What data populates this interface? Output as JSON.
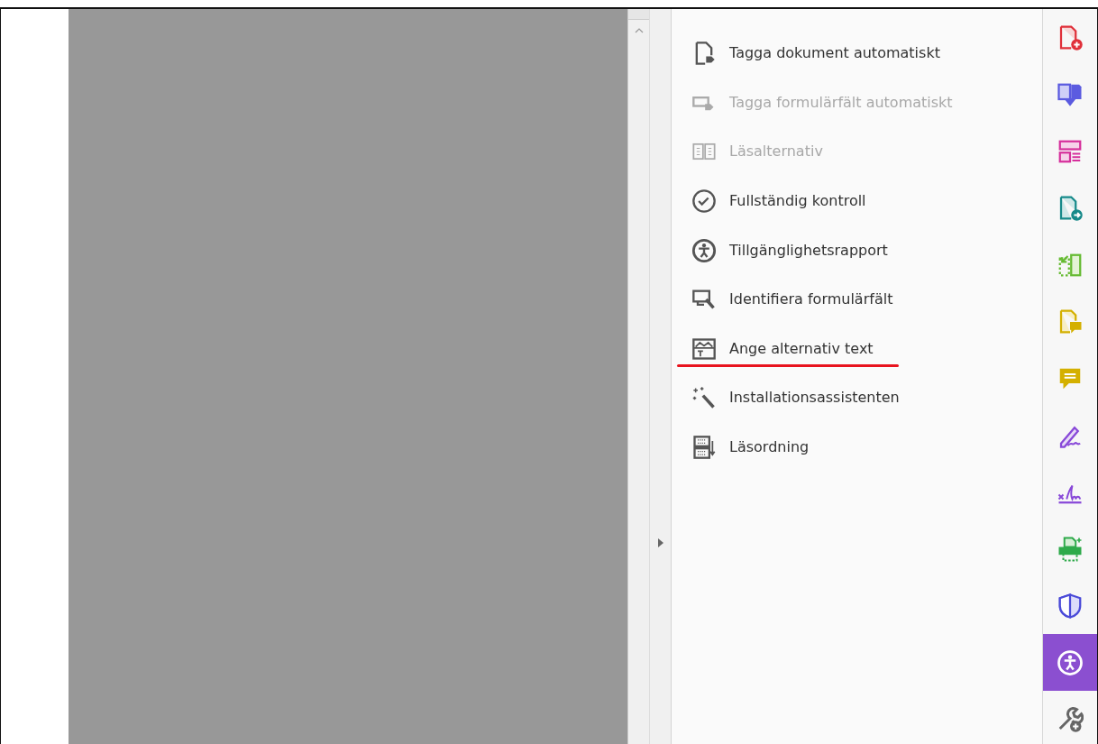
{
  "tools_panel": {
    "items": [
      {
        "label": "Tagga dokument automatiskt",
        "kind": "tagdoc",
        "disabled": false,
        "underlined": false
      },
      {
        "label": "Tagga formulärfält automatiskt",
        "kind": "tagform",
        "disabled": true,
        "underlined": false
      },
      {
        "label": "Läsalternativ",
        "kind": "reading",
        "disabled": true,
        "underlined": false
      },
      {
        "label": "Fullständig kontroll",
        "kind": "check",
        "disabled": false,
        "underlined": false
      },
      {
        "label": "Tillgänglighetsrapport",
        "kind": "access",
        "disabled": false,
        "underlined": false
      },
      {
        "label": "Identifiera formulärfält",
        "kind": "identify",
        "disabled": false,
        "underlined": false
      },
      {
        "label": "Ange alternativ text",
        "kind": "alttext",
        "disabled": false,
        "underlined": true
      },
      {
        "label": "Installationsassistenten",
        "kind": "wizard",
        "disabled": false,
        "underlined": false
      },
      {
        "label": "Läsordning",
        "kind": "order",
        "disabled": false,
        "underlined": false
      }
    ]
  },
  "right_toolbar": [
    {
      "kind": "create",
      "selected": false
    },
    {
      "kind": "export",
      "selected": false
    },
    {
      "kind": "organize",
      "selected": false
    },
    {
      "kind": "send",
      "selected": false
    },
    {
      "kind": "crop",
      "selected": false
    },
    {
      "kind": "filecomment",
      "selected": false
    },
    {
      "kind": "comment",
      "selected": false
    },
    {
      "kind": "sign",
      "selected": false
    },
    {
      "kind": "xsign",
      "selected": false
    },
    {
      "kind": "print",
      "selected": false
    },
    {
      "kind": "protect",
      "selected": false
    },
    {
      "kind": "access",
      "selected": true
    },
    {
      "kind": "moretools",
      "selected": false
    }
  ]
}
